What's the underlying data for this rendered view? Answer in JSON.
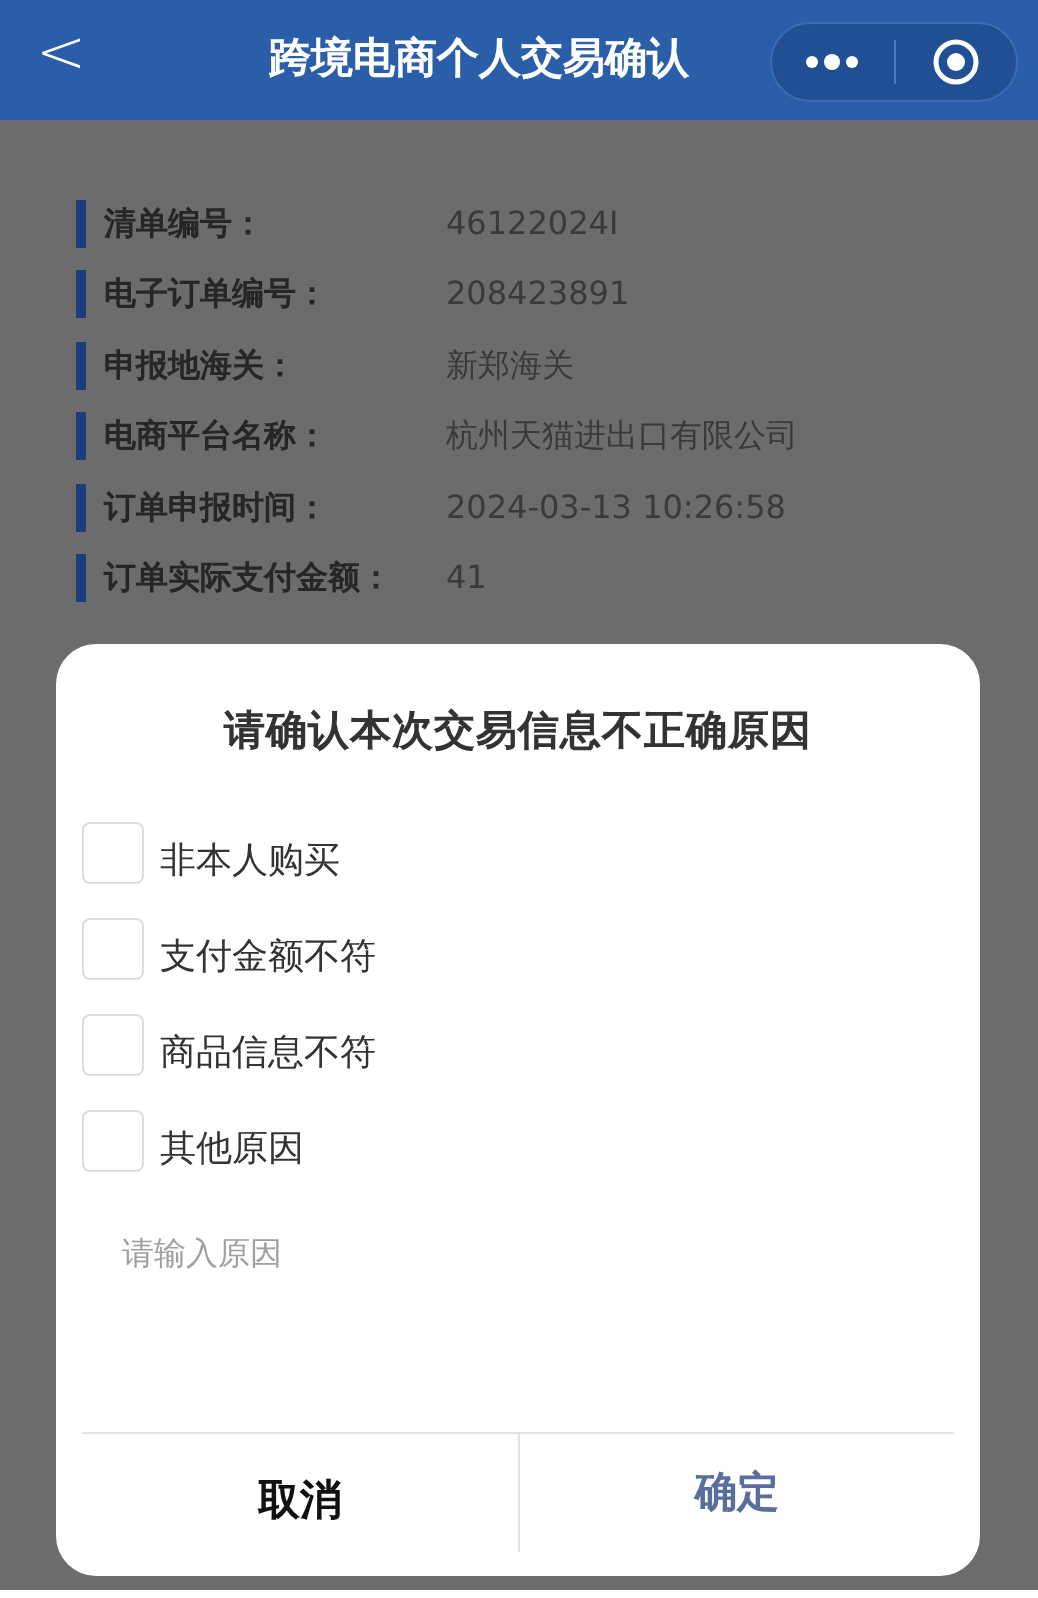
{
  "header": {
    "back": "<",
    "title": "跨境电商个人交易确认"
  },
  "fields": [
    {
      "label": "清单编号：",
      "value": "46122024I"
    },
    {
      "label": "电子订单编号：",
      "value": "208423891"
    },
    {
      "label": "申报地海关：",
      "value": "新郑海关"
    },
    {
      "label": "电商平台名称：",
      "value": "杭州天猫进出口有限公司"
    },
    {
      "label": "订单申报时间：",
      "value": "2024-03-13 10:26:58"
    },
    {
      "label": "订单实际支付金额：",
      "value": "41"
    }
  ],
  "dialog": {
    "title": "请确认本次交易信息不正确原因",
    "options": [
      {
        "label": "非本人购买",
        "checked": false
      },
      {
        "label": "支付金额不符",
        "checked": false
      },
      {
        "label": "商品信息不符",
        "checked": false
      },
      {
        "label": "其他原因",
        "checked": false
      }
    ],
    "reason": {
      "placeholder": "请输入原因"
    },
    "buttons": [
      {
        "label": "取消",
        "kind": "cancel"
      },
      {
        "label": "确定",
        "kind": "confirm"
      }
    ]
  }
}
